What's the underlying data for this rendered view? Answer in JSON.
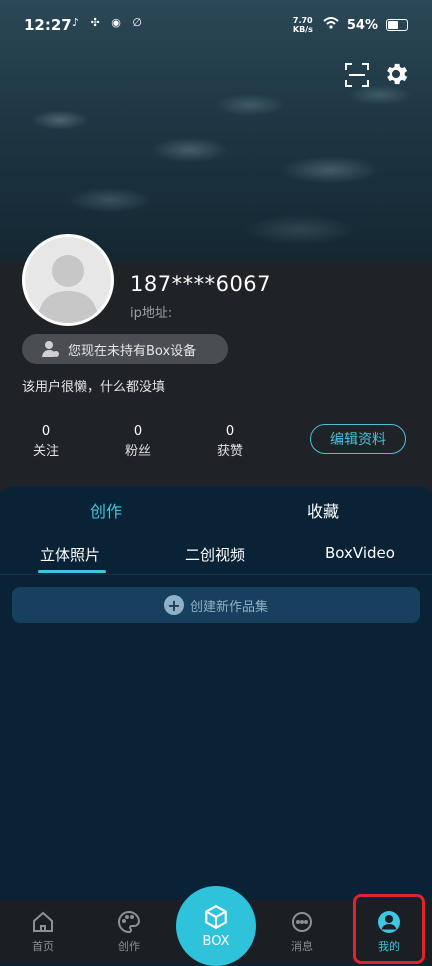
{
  "status_bar": {
    "time": "12:27",
    "app_icons": "♪ ✣ ◉ ∅",
    "net_speed": "7.70 KB/s",
    "battery": "54%"
  },
  "header": {
    "scan_icon": "scan-icon",
    "settings_icon": "gear-icon"
  },
  "profile": {
    "username": "187****6067",
    "ip_label": "ip地址:",
    "device_notice": "您现在未持有Box设备",
    "bio": "该用户很懒，什么都没填",
    "stats": [
      {
        "value": "0",
        "label": "关注"
      },
      {
        "value": "0",
        "label": "粉丝"
      },
      {
        "value": "0",
        "label": "获赞"
      }
    ],
    "edit_label": "编辑资料"
  },
  "tabs": {
    "main": [
      "创作",
      "收藏"
    ],
    "sub": [
      "立体照片",
      "二创视频",
      "BoxVideo"
    ],
    "active_main": "创作",
    "active_sub": "立体照片"
  },
  "create_set_label": "创建新作品集",
  "nav": {
    "items": [
      "首页",
      "创作",
      "BOX",
      "消息",
      "我的"
    ],
    "active": "我的"
  },
  "colors": {
    "accent": "#3fc6e2",
    "box_button": "#2ec3db",
    "highlight": "#e0242c"
  }
}
